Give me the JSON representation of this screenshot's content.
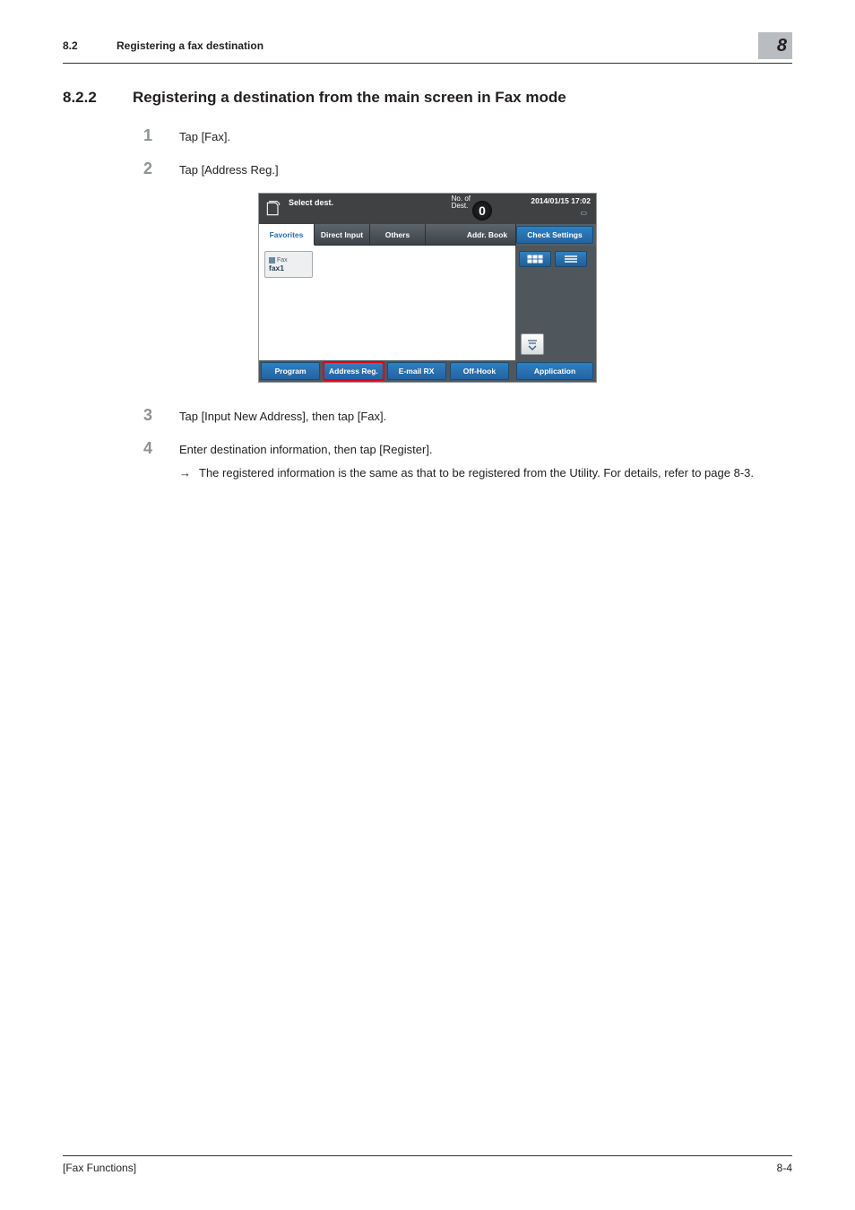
{
  "header": {
    "section_number": "8.2",
    "section_title": "Registering a fax destination",
    "chapter": "8"
  },
  "section": {
    "number": "8.2.2",
    "title": "Registering a destination from the main screen in Fax mode"
  },
  "steps": [
    {
      "num": "1",
      "text": "Tap [Fax]."
    },
    {
      "num": "2",
      "text": "Tap [Address Reg.]"
    },
    {
      "num": "3",
      "text": "Tap [Input New Address], then tap [Fax]."
    },
    {
      "num": "4",
      "text": "Enter destination information, then tap [Register]."
    }
  ],
  "substep": {
    "arrow": "→",
    "text": "The registered information is the same as that to be registered from the Utility. For details, refer to page 8-3."
  },
  "screenshot": {
    "select_dest": "Select dest.",
    "no_of_dest_label": "No. of\nDest.",
    "dest_count": "0",
    "datetime": "2014/01/15 17:02",
    "tabs": {
      "favorites": "Favorites",
      "direct_input": "Direct Input",
      "others": "Others",
      "addr_book": "Addr. Book"
    },
    "check_settings": "Check Settings",
    "dest_card": {
      "type": "Fax",
      "name": "fax1"
    },
    "bottom_buttons": {
      "program": "Program",
      "address_reg": "Address Reg.",
      "email_rx": "E-mail RX",
      "off_hook": "Off-Hook",
      "application": "Application"
    }
  },
  "footer": {
    "left": "[Fax Functions]",
    "right": "8-4"
  }
}
